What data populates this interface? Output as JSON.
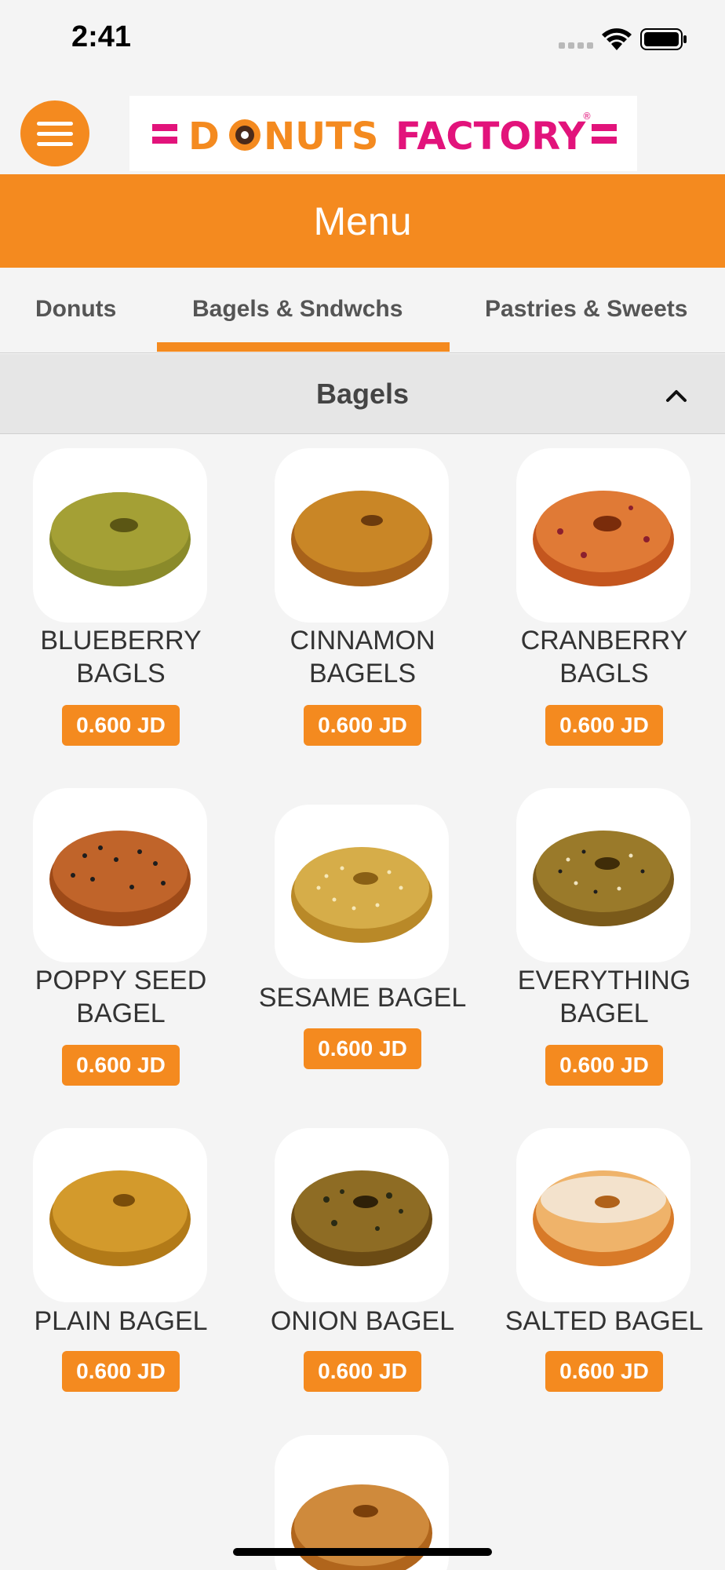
{
  "status_bar": {
    "time": "2:41"
  },
  "brand": {
    "name": "DONUTS FACTORY",
    "accent": "#f48a1f",
    "pink": "#e2137b"
  },
  "banner": {
    "title": "Menu"
  },
  "tabs": [
    {
      "label": "Donuts"
    },
    {
      "label": "Bagels & Sndwchs",
      "active": true
    },
    {
      "label": "Pastries & Sweets"
    }
  ],
  "section": {
    "title": "Bagels",
    "expanded": true
  },
  "products": [
    {
      "name": "BLUEBERRY BAGLS",
      "price": "0.600 JD"
    },
    {
      "name": "CINNAMON BAGELS",
      "price": "0.600 JD"
    },
    {
      "name": "CRANBERRY BAGLS",
      "price": "0.600 JD"
    },
    {
      "name": "POPPY SEED BAGEL",
      "price": "0.600 JD"
    },
    {
      "name": "SESAME BAGEL",
      "price": "0.600 JD"
    },
    {
      "name": "EVERYTHING BAGEL",
      "price": "0.600 JD"
    },
    {
      "name": "PLAIN BAGEL",
      "price": "0.600 JD"
    },
    {
      "name": "ONION BAGEL",
      "price": "0.600 JD"
    },
    {
      "name": "SALTED BAGEL",
      "price": "0.600 JD"
    }
  ]
}
